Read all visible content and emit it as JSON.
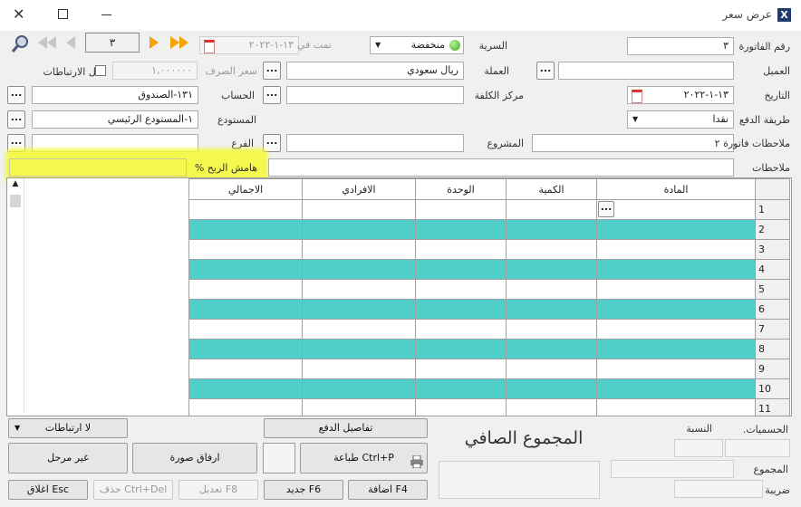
{
  "window": {
    "title": "عرض سعر"
  },
  "toolbar": {
    "record_number": "٣"
  },
  "form": {
    "invoice_number_label": "رقم الفاتورة",
    "invoice_number_value": "٣",
    "serial_label": "السرية",
    "serial_value": "منخفضة",
    "done_in_label": "تمت في",
    "done_in_value": "١٣-١-٢٠٢٢",
    "customer_label": "العميل",
    "customer_value": "",
    "currency_label": "العملة",
    "currency_value": "ريال سعودي",
    "exchange_rate_label": "سعر الصرف",
    "exchange_rate_value": "١,٠٠٠٠٠٠",
    "lock_links_label": "قفل الارتباطات",
    "date_label": "التاريخ",
    "date_value": "١٣-١-٢٠٢٢",
    "cost_center_label": "مركز الكلفة",
    "cost_center_value": "",
    "account_label": "الحساب",
    "account_value": "١٣١-الصندوق",
    "payment_method_label": "طريقة الدفع",
    "payment_method_value": "نقدا",
    "warehouse_label": "المستودع",
    "warehouse_value": "١-المستودع الرئيسي",
    "invoice_notes2_label": "ملاحظات فاتورة ٢",
    "invoice_notes2_value": "",
    "project_label": "المشروع",
    "project_value": "",
    "branch_label": "الفرع",
    "branch_value": "",
    "notes_label": "ملاحظات",
    "notes_value": "",
    "profit_margin_label": "هامش الربح %",
    "profit_margin_value": ""
  },
  "grid": {
    "columns": [
      "المادة",
      "الكمية",
      "الوحدة",
      "الافرادي",
      "الاجمالي"
    ],
    "row_numbers": [
      "1",
      "2",
      "3",
      "4",
      "5",
      "6",
      "7",
      "8",
      "9",
      "10",
      "11"
    ]
  },
  "bottom": {
    "no_links": "لا ارتباطات",
    "payment_details": "تفاصيل الدفع",
    "net_total": "المجموع الصافي",
    "discounts_label": "الحسميات.",
    "ratio_label": "النسبة",
    "total_label": "المجموع",
    "tax_label": "ضريبة",
    "unposted": "غير مرحل",
    "attach_image": "ارفاق صورة",
    "print": "طباعة Ctrl+P",
    "close": "اغلاق Esc",
    "delete": "حذف Ctrl+Del",
    "edit": "تعديل F8",
    "new": "جديد F6",
    "add": "اضافة F4"
  },
  "colors": {
    "row_accent": "#4ecfca",
    "highlight": "#f5fa28"
  }
}
